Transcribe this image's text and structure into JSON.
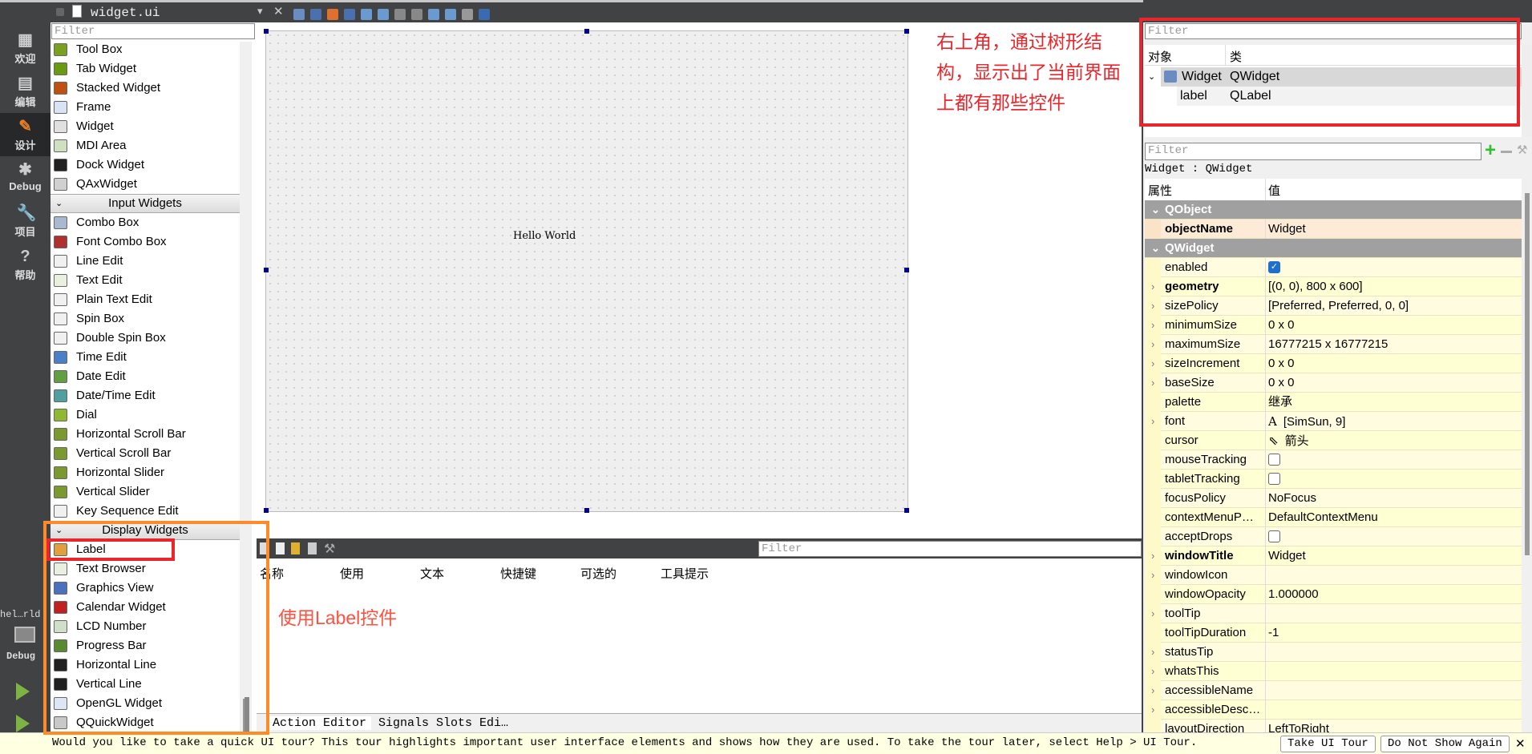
{
  "toolbar": {
    "file_name": "widget.ui",
    "close_label": "✕",
    "dropdown": "▾",
    "icons": [
      "edit-widgets-icon",
      "edit-signals-slots-icon",
      "edit-buddies-icon",
      "edit-tab-order-icon",
      "layout-horizontal-icon",
      "layout-vertical-icon",
      "layout-horizontal-splitter-icon",
      "layout-vertical-splitter-icon",
      "layout-form-icon",
      "layout-grid-icon",
      "break-layout-icon",
      "adjust-size-icon"
    ]
  },
  "modes": [
    {
      "label": "欢迎",
      "icon": "grid-icon",
      "glyph": "▦"
    },
    {
      "label": "编辑",
      "icon": "edit-doc-icon",
      "glyph": "▤"
    },
    {
      "label": "设计",
      "icon": "pencil-icon",
      "glyph": "✎",
      "selected": true
    },
    {
      "label": "Debug",
      "icon": "bug-icon",
      "glyph": "✱"
    },
    {
      "label": "项目",
      "icon": "wrench-icon",
      "glyph": "🔧"
    },
    {
      "label": "帮助",
      "icon": "help-icon",
      "glyph": "?"
    }
  ],
  "run_panel": {
    "project": "hel…rld",
    "target": "Debug"
  },
  "widget_box": {
    "filter_placeholder": "Filter",
    "rows": [
      {
        "label": "Tool Box",
        "color": "#7aa020"
      },
      {
        "label": "Tab Widget",
        "color": "#6a9a10"
      },
      {
        "label": "Stacked Widget",
        "color": "#c05010"
      },
      {
        "label": "Frame",
        "color": "#d8e4f4"
      },
      {
        "label": "Widget",
        "color": "#e0e0e0"
      },
      {
        "label": "MDI Area",
        "color": "#cfe0c0"
      },
      {
        "label": "Dock Widget",
        "color": "#202020"
      },
      {
        "label": "QAxWidget",
        "color": "#d0d0d0"
      },
      {
        "category": "Input Widgets"
      },
      {
        "label": "Combo Box",
        "color": "#a8b8d0"
      },
      {
        "label": "Font Combo Box",
        "color": "#b03030"
      },
      {
        "label": "Line Edit",
        "color": "#f0f0f0"
      },
      {
        "label": "Text Edit",
        "color": "#e8f0e0"
      },
      {
        "label": "Plain Text Edit",
        "color": "#f0f0f0"
      },
      {
        "label": "Spin Box",
        "color": "#f0f0f0"
      },
      {
        "label": "Double Spin Box",
        "color": "#f0f0f0"
      },
      {
        "label": "Time Edit",
        "color": "#4a80c8"
      },
      {
        "label": "Date Edit",
        "color": "#60a040"
      },
      {
        "label": "Date/Time Edit",
        "color": "#50a0a0"
      },
      {
        "label": "Dial",
        "color": "#90b830"
      },
      {
        "label": "Horizontal Scroll Bar",
        "color": "#7a9a30"
      },
      {
        "label": "Vertical Scroll Bar",
        "color": "#7a9a30"
      },
      {
        "label": "Horizontal Slider",
        "color": "#7a9a30"
      },
      {
        "label": "Vertical Slider",
        "color": "#7a9a30"
      },
      {
        "label": "Key Sequence Edit",
        "color": "#f0f0f0"
      },
      {
        "category": "Display Widgets"
      },
      {
        "label": "Label",
        "color": "#e0a040"
      },
      {
        "label": "Text Browser",
        "color": "#e8f0e0"
      },
      {
        "label": "Graphics View",
        "color": "#4a70c0"
      },
      {
        "label": "Calendar Widget",
        "color": "#c02020"
      },
      {
        "label": "LCD Number",
        "color": "#d0e0c8"
      },
      {
        "label": "Progress Bar",
        "color": "#5a8a30"
      },
      {
        "label": "Horizontal Line",
        "color": "#202020"
      },
      {
        "label": "Vertical Line",
        "color": "#202020"
      },
      {
        "label": "OpenGL Widget",
        "color": "#dde6f4"
      },
      {
        "label": "QQuickWidget",
        "color": "#c8c8c8"
      }
    ]
  },
  "form": {
    "label_text": "Hello World"
  },
  "action_editor": {
    "filter_placeholder": "Filter",
    "columns": [
      "名称",
      "使用",
      "文本",
      "快捷键",
      "可选的",
      "工具提示"
    ],
    "tabs": [
      "Action Editor",
      "Signals  Slots Edi…"
    ]
  },
  "object_inspector": {
    "filter_placeholder": "Filter",
    "headers": [
      "对象",
      "类"
    ],
    "rows": [
      {
        "object": "Widget",
        "class": "QWidget"
      },
      {
        "object": "label",
        "class": "QLabel"
      }
    ]
  },
  "property_editor": {
    "filter_placeholder": "Filter",
    "context": "Widget : QWidget",
    "headers": [
      "属性",
      "值"
    ],
    "rows": [
      {
        "group": "QObject"
      },
      {
        "name": "objectName",
        "value": "Widget",
        "bold": true,
        "highlight": true
      },
      {
        "group": "QWidget"
      },
      {
        "name": "enabled",
        "checkbox": true,
        "checked": true
      },
      {
        "name": "geometry",
        "value": "[(0, 0), 800 x 600]",
        "bold": true,
        "expandable": true
      },
      {
        "name": "sizePolicy",
        "value": "[Preferred, Preferred, 0, 0]",
        "expandable": true
      },
      {
        "name": "minimumSize",
        "value": "0 x 0",
        "expandable": true
      },
      {
        "name": "maximumSize",
        "value": "16777215 x 16777215",
        "expandable": true
      },
      {
        "name": "sizeIncrement",
        "value": "0 x 0",
        "expandable": true
      },
      {
        "name": "baseSize",
        "value": "0 x 0",
        "expandable": true
      },
      {
        "name": "palette",
        "value": "继承"
      },
      {
        "name": "font",
        "value": "[SimSun, 9]",
        "prefix": "A",
        "expandable": true
      },
      {
        "name": "cursor",
        "value": "箭头",
        "prefix": "⇖"
      },
      {
        "name": "mouseTracking",
        "checkbox": true,
        "checked": false
      },
      {
        "name": "tabletTracking",
        "checkbox": true,
        "checked": false
      },
      {
        "name": "focusPolicy",
        "value": "NoFocus"
      },
      {
        "name": "contextMenuP…",
        "value": "DefaultContextMenu"
      },
      {
        "name": "acceptDrops",
        "checkbox": true,
        "checked": false
      },
      {
        "name": "windowTitle",
        "value": "Widget",
        "bold": true,
        "expandable": true
      },
      {
        "name": "windowIcon",
        "value": "",
        "expandable": true
      },
      {
        "name": "windowOpacity",
        "value": "1.000000"
      },
      {
        "name": "toolTip",
        "value": "",
        "expandable": true
      },
      {
        "name": "toolTipDuration",
        "value": "-1"
      },
      {
        "name": "statusTip",
        "value": "",
        "expandable": true
      },
      {
        "name": "whatsThis",
        "value": "",
        "expandable": true
      },
      {
        "name": "accessibleName",
        "value": "",
        "expandable": true
      },
      {
        "name": "accessibleDesc…",
        "value": "",
        "expandable": true
      },
      {
        "name": "layoutDirection",
        "value": "LeftToRight"
      }
    ]
  },
  "notification": {
    "message": "Would you like to take a quick UI tour? This tour highlights important user interface elements and shows how they are used. To take the tour later, select Help > UI Tour.",
    "take_tour": "Take UI Tour",
    "dont_show": "Do Not Show Again",
    "close": "✕"
  },
  "annotations": {
    "inspector_note": [
      "右上角，通过树形结",
      "构，显示出了当前界面",
      "上都有那些控件"
    ],
    "label_note": "使用Label控件",
    "colors": {
      "red": "#e8262c",
      "orange": "#ff8a2a"
    }
  }
}
